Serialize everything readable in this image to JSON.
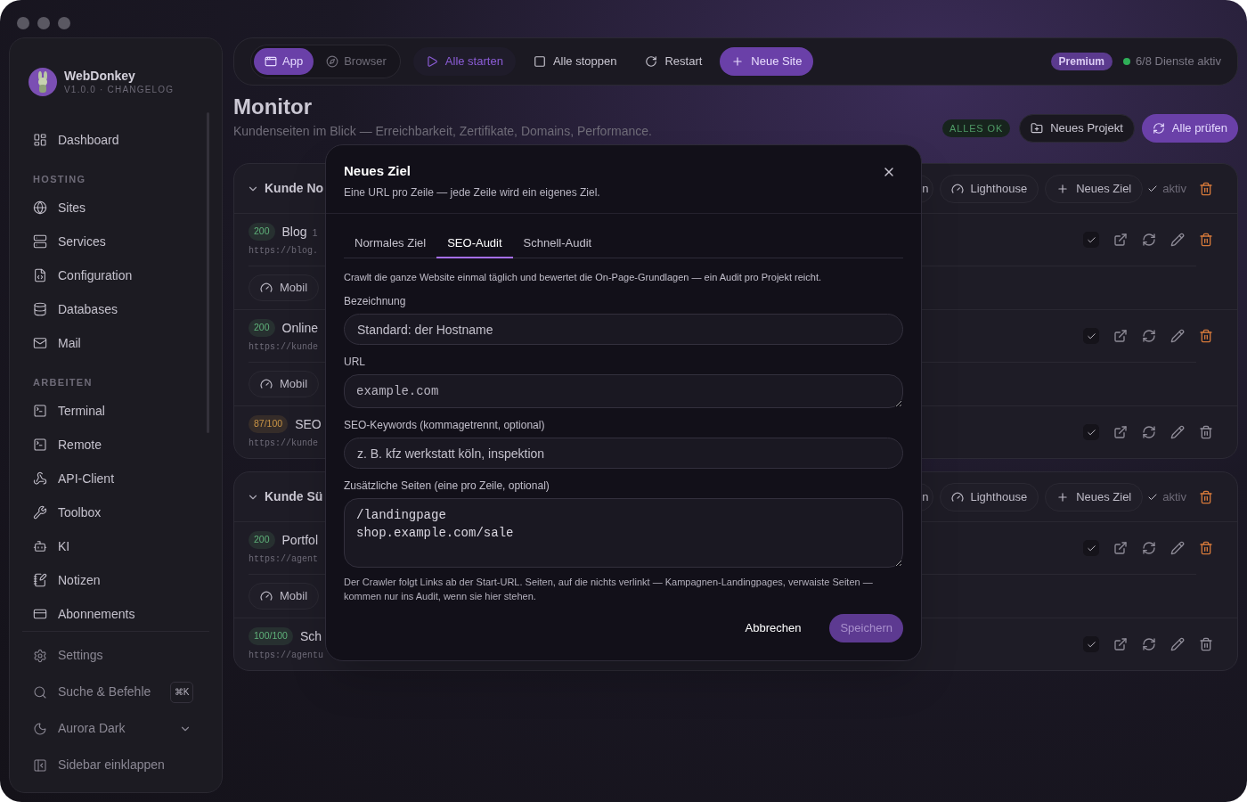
{
  "sidebar": {
    "app_name": "WebDonkey",
    "version": "V1.0.0 · CHANGELOG",
    "sections": [
      {
        "items": [
          {
            "label": "Dashboard",
            "selected": false
          }
        ]
      },
      {
        "heading": "HOSTING",
        "items": [
          {
            "label": "Sites",
            "selected": false
          },
          {
            "label": "Services",
            "selected": false
          },
          {
            "label": "Configuration",
            "selected": false
          },
          {
            "label": "Databases",
            "selected": false
          },
          {
            "label": "Mail",
            "selected": false
          }
        ]
      },
      {
        "heading": "ARBEITEN",
        "items": [
          {
            "label": "Terminal",
            "selected": false
          },
          {
            "label": "Remote",
            "selected": false
          },
          {
            "label": "API-Client",
            "selected": false
          },
          {
            "label": "Toolbox",
            "selected": false
          },
          {
            "label": "KI",
            "selected": false
          },
          {
            "label": "Notizen",
            "selected": false
          },
          {
            "label": "Abonnements",
            "selected": false
          }
        ]
      }
    ],
    "footer": [
      {
        "label": "Settings",
        "kind": "settings"
      },
      {
        "label": "Suche & Befehle",
        "kind": "search",
        "shortcut": "⌘K"
      },
      {
        "label": "Aurora Dark",
        "kind": "theme"
      },
      {
        "label": "Sidebar einklappen",
        "kind": "collapse"
      }
    ]
  },
  "toolbar": {
    "view_tabs": [
      {
        "label": "App",
        "selected": true
      },
      {
        "label": "Browser",
        "selected": false
      }
    ],
    "actions": [
      {
        "label": "Alle starten",
        "kind": "start"
      },
      {
        "label": "Alle stoppen",
        "kind": "stop"
      },
      {
        "label": "Restart",
        "kind": "restart"
      },
      {
        "label": "Neue Site",
        "kind": "primary"
      }
    ],
    "plan_badge": "Premium",
    "services_status": "6/8 Dienste aktiv"
  },
  "page": {
    "title": "Monitor",
    "subtitle": "Kundenseiten im Blick — Erreichbarkeit, Zertifikate, Domains, Performance.",
    "status_badge": "ALLES OK",
    "buttons": [
      {
        "label": "Neues Projekt",
        "kind": "folder"
      },
      {
        "label": "Alle prüfen",
        "kind": "primary"
      }
    ]
  },
  "projects": [
    {
      "name": "Kunde No",
      "expanded": true,
      "active": true,
      "active_label": "aktiv",
      "header_buttons": [
        {
          "label": "n",
          "kind": "plain"
        },
        {
          "label": "Lighthouse",
          "kind": "lighthouse"
        },
        {
          "label": "Neues Ziel",
          "kind": "add"
        }
      ],
      "targets": [
        {
          "badge": "200",
          "color": "#5fb27a",
          "name": "Blog",
          "detail": "1",
          "url": "https://blog.",
          "mobile_button": "Mobil",
          "kind": "monitor",
          "checked": true
        },
        {
          "badge": "200",
          "color": "#5fb27a",
          "name": "Online",
          "url": "https://kunde",
          "mobile_button": "Mobil",
          "kind": "monitor",
          "checked": true
        },
        {
          "badge": "87/100",
          "color": "#c99445",
          "name": "SEO",
          "url": "https://kunde",
          "kind": "audit",
          "checked": true
        }
      ]
    },
    {
      "name": "Kunde Sü",
      "expanded": true,
      "active": true,
      "active_label": "aktiv",
      "header_buttons": [
        {
          "label": "n",
          "kind": "plain"
        },
        {
          "label": "Lighthouse",
          "kind": "lighthouse"
        },
        {
          "label": "Neues Ziel",
          "kind": "add"
        }
      ],
      "targets": [
        {
          "badge": "200",
          "color": "#5fb27a",
          "name": "Portfol",
          "url": "https://agent",
          "mobile_button": "Mobil",
          "kind": "monitor",
          "checked": true
        },
        {
          "badge": "100/100",
          "color": "#5fb27a",
          "name": "Sch",
          "url": "https://agentu",
          "kind": "audit",
          "checked": true
        }
      ]
    }
  ],
  "dialog": {
    "title": "Neues Ziel",
    "subtitle": "Eine URL pro Zeile — jede Zeile wird ein eigenes Ziel.",
    "tabs": [
      {
        "label": "Normales Ziel",
        "selected": false
      },
      {
        "label": "SEO-Audit",
        "selected": true
      },
      {
        "label": "Schnell-Audit",
        "selected": false
      }
    ],
    "description": "Crawlt die ganze Website einmal täglich und bewertet die On-Page-Grundlagen — ein Audit pro Projekt reicht.",
    "fields": [
      {
        "label": "Bezeichnung",
        "kind": "input",
        "placeholder": "Standard: der Hostname"
      },
      {
        "label": "URL",
        "kind": "textarea",
        "placeholder": "example.com"
      },
      {
        "label": "SEO-Keywords (kommagetrennt, optional)",
        "kind": "input",
        "placeholder": "z. B. kfz werkstatt köln, inspektion"
      },
      {
        "label": "Zusätzliche Seiten (eine pro Zeile, optional)",
        "kind": "textarea",
        "value": "/landingpage\nshop.example.com/sale"
      }
    ],
    "hint": "Der Crawler folgt Links ab der Start-URL. Seiten, auf die nichts verlinkt — Kampagnen-Landingpages, verwaiste Seiten — kommen nur ins Audit, wenn sie hier stehen.",
    "buttons": [
      {
        "label": "Abbrechen",
        "kind": "cancel",
        "disabled": false
      },
      {
        "label": "Speichern",
        "kind": "primary",
        "disabled": true
      }
    ]
  }
}
